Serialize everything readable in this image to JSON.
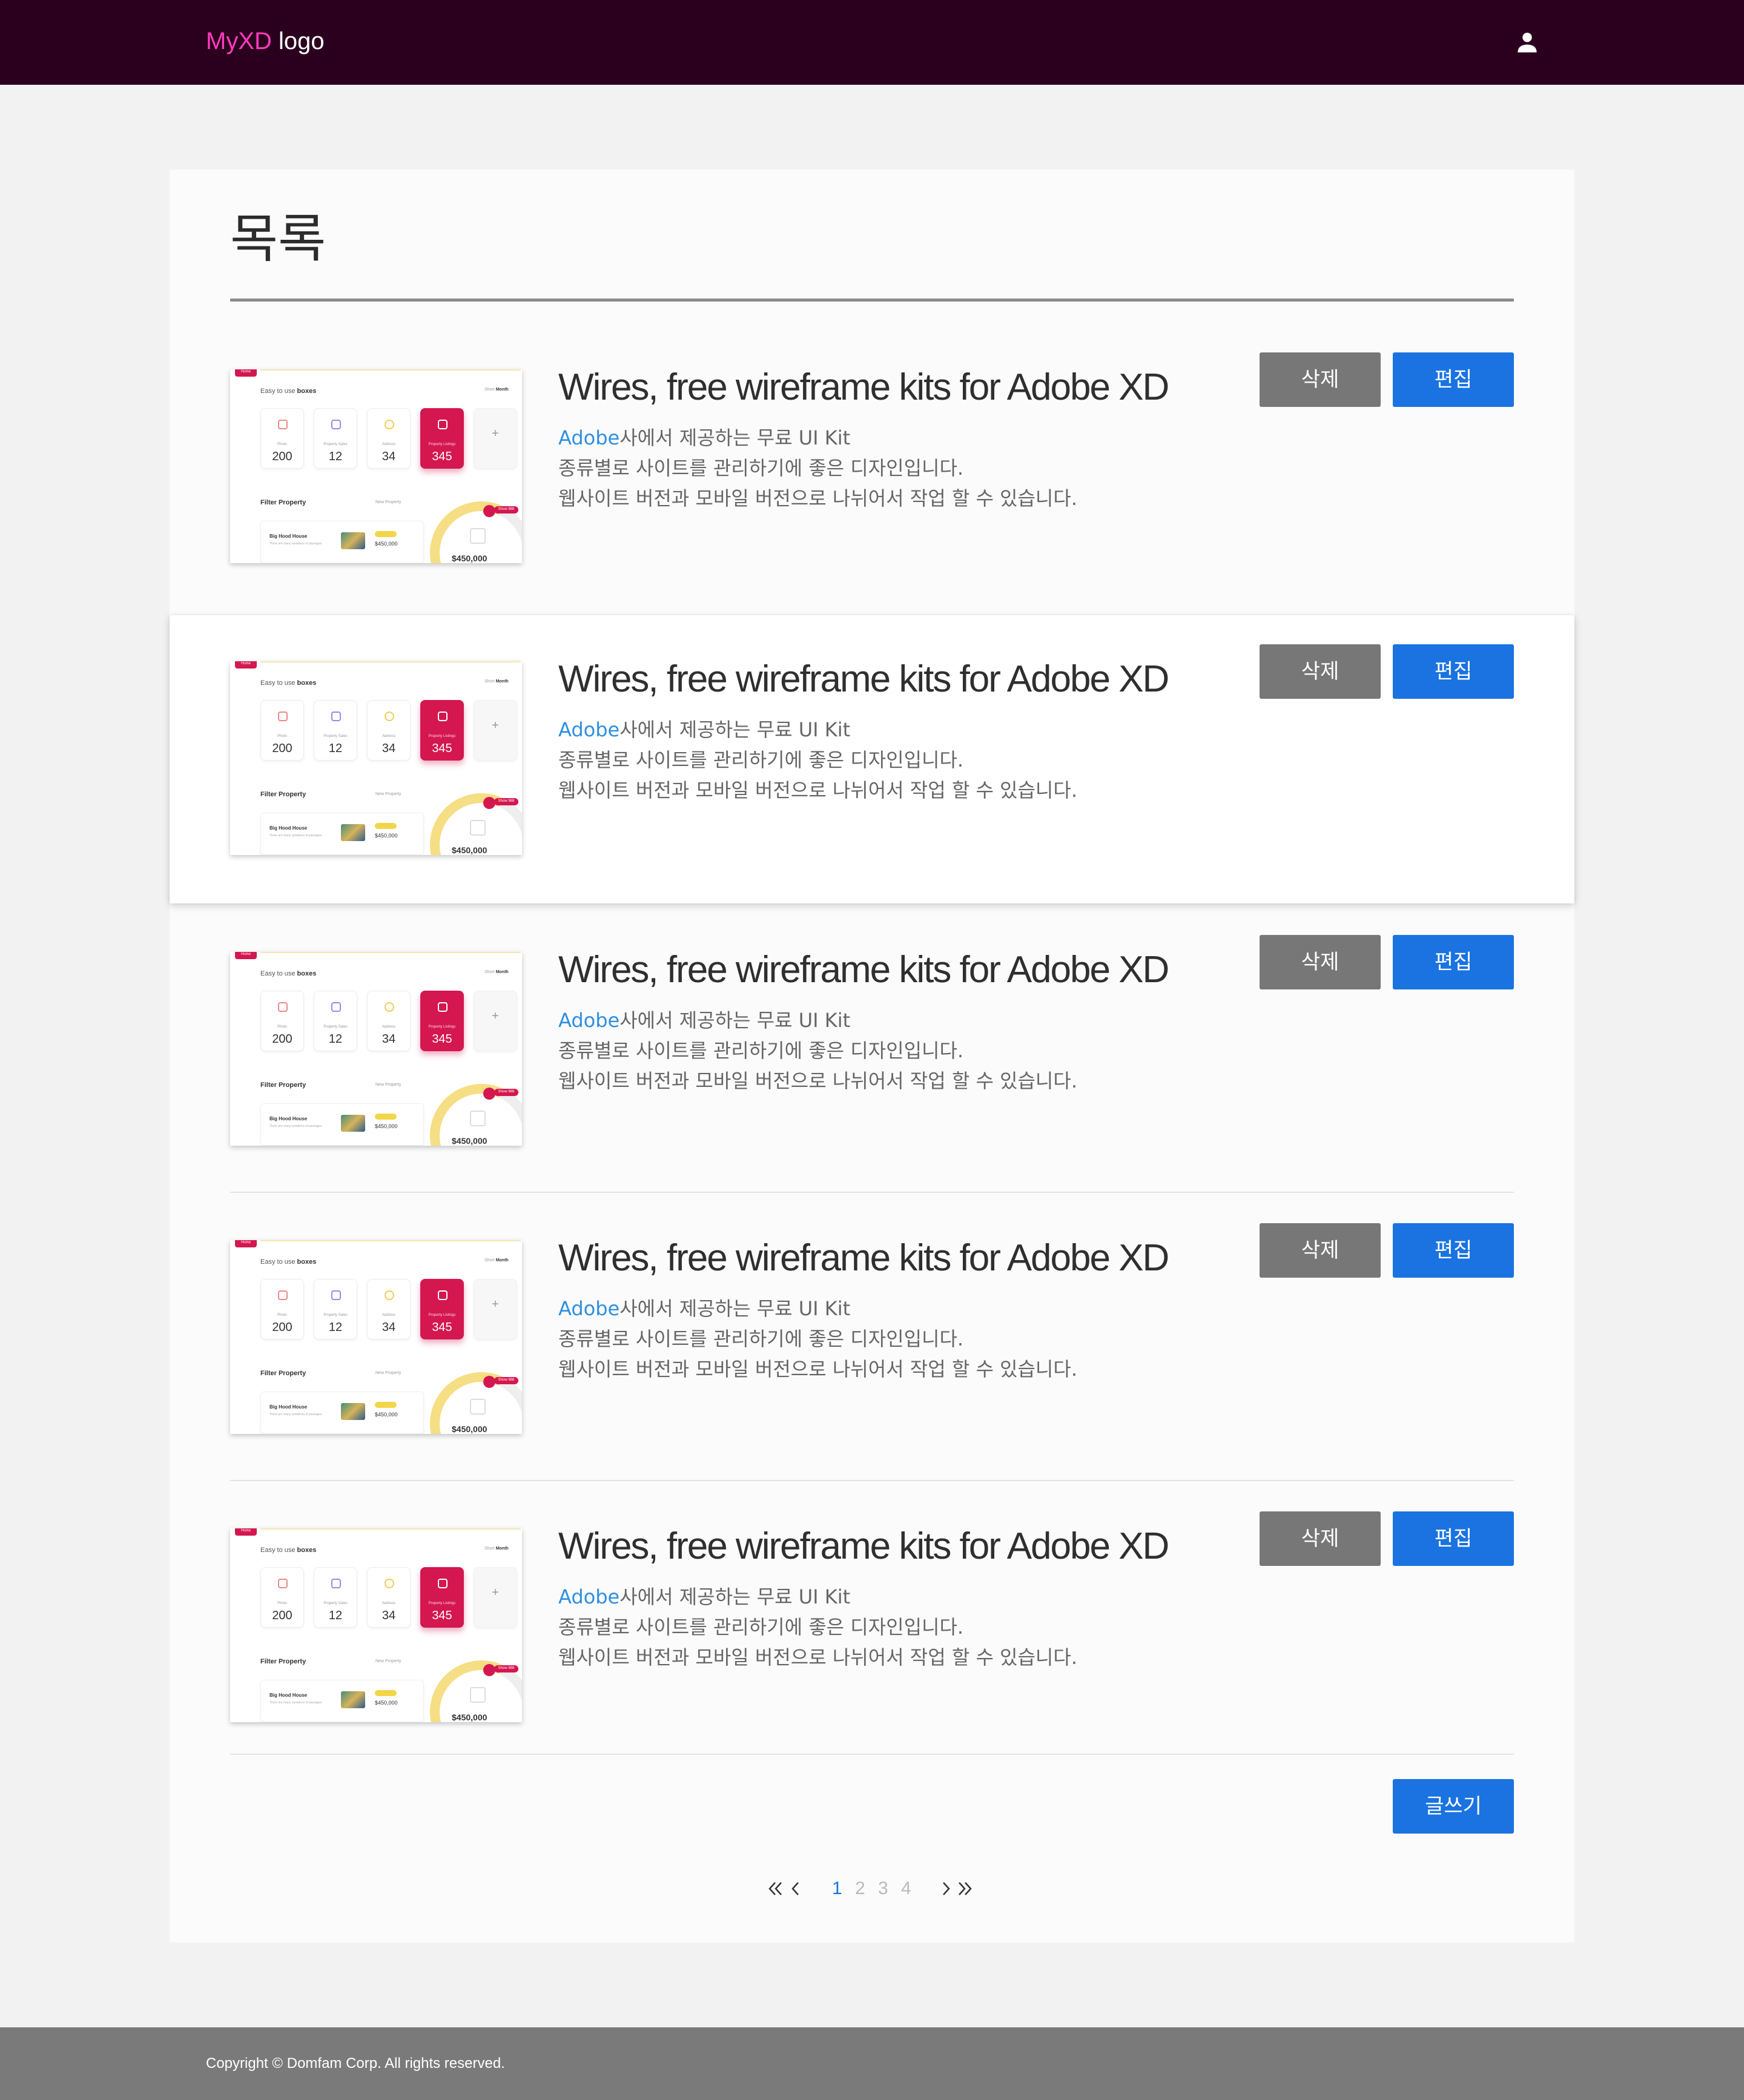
{
  "header": {
    "logo_brand": "MyXD",
    "logo_text": "logo",
    "user_icon": "user-icon"
  },
  "main": {
    "title": "목록"
  },
  "thumbnail": {
    "badge": "Home",
    "heading_bold": "Easy to use ",
    "heading_strong": "boxes",
    "toggle_short": "Short",
    "toggle_month": "Month",
    "stats": [
      {
        "label": "Photo",
        "value": "200"
      },
      {
        "label": "Property Sales",
        "value": "12"
      },
      {
        "label": "Address",
        "value": "34"
      },
      {
        "label": "Property Listings",
        "value": "345"
      }
    ],
    "plus": "+",
    "filter_title": "Filter Property",
    "new_property": "New Property",
    "listing_title": "Big Hood House",
    "listing_desc": "There are many variations of passages",
    "listing_price": "$450,000",
    "gauge_badge": "Show 988",
    "gauge_price": "$450,000"
  },
  "posts": [
    {
      "title": "Wires, free wireframe kits for Adobe XD",
      "desc_accent": "Adobe",
      "desc_line1": "사에서 제공하는 무료 UI Kit",
      "desc_line2": "종류별로 사이트를 관리하기에 좋은 디자인입니다.",
      "desc_line3": "웹사이트 버전과 모바일 버전으로 나뉘어서 작업 할 수 있습니다.",
      "delete_label": "삭제",
      "edit_label": "편집"
    },
    {
      "title": "Wires, free wireframe kits for Adobe XD",
      "desc_accent": "Adobe",
      "desc_line1": "사에서 제공하는 무료 UI Kit",
      "desc_line2": "종류별로 사이트를 관리하기에 좋은 디자인입니다.",
      "desc_line3": "웹사이트 버전과 모바일 버전으로 나뉘어서 작업 할 수 있습니다.",
      "delete_label": "삭제",
      "edit_label": "편집"
    },
    {
      "title": "Wires, free wireframe kits for Adobe XD",
      "desc_accent": "Adobe",
      "desc_line1": "사에서 제공하는 무료 UI Kit",
      "desc_line2": "종류별로 사이트를 관리하기에 좋은 디자인입니다.",
      "desc_line3": "웹사이트 버전과 모바일 버전으로 나뉘어서 작업 할 수 있습니다.",
      "delete_label": "삭제",
      "edit_label": "편집"
    },
    {
      "title": "Wires, free wireframe kits for Adobe XD",
      "desc_accent": "Adobe",
      "desc_line1": "사에서 제공하는 무료 UI Kit",
      "desc_line2": "종류별로 사이트를 관리하기에 좋은 디자인입니다.",
      "desc_line3": "웹사이트 버전과 모바일 버전으로 나뉘어서 작업 할 수 있습니다.",
      "delete_label": "삭제",
      "edit_label": "편집"
    },
    {
      "title": "Wires, free wireframe kits for Adobe XD",
      "desc_accent": "Adobe",
      "desc_line1": "사에서 제공하는 무료 UI Kit",
      "desc_line2": "종류별로 사이트를 관리하기에 좋은 디자인입니다.",
      "desc_line3": "웹사이트 버전과 모바일 버전으로 나뉘어서 작업 할 수 있습니다.",
      "delete_label": "삭제",
      "edit_label": "편집"
    }
  ],
  "actions": {
    "write_label": "글쓰기"
  },
  "pagination": {
    "first_icon": "double-chevron-left-icon",
    "prev_icon": "chevron-left-icon",
    "pages": [
      "1",
      "2",
      "3",
      "4"
    ],
    "current": "1",
    "next_icon": "chevron-right-icon",
    "last_icon": "double-chevron-right-icon"
  },
  "footer": {
    "copyright": "Copyright © Domfam Corp. All rights reserved."
  },
  "colors": {
    "header_bg": "#2b001e",
    "brand": "#ff3bbd",
    "primary": "#1a73e0",
    "delete": "#777777",
    "footer_bg": "#7a7a7a",
    "accent_text": "#2f8fe0"
  }
}
